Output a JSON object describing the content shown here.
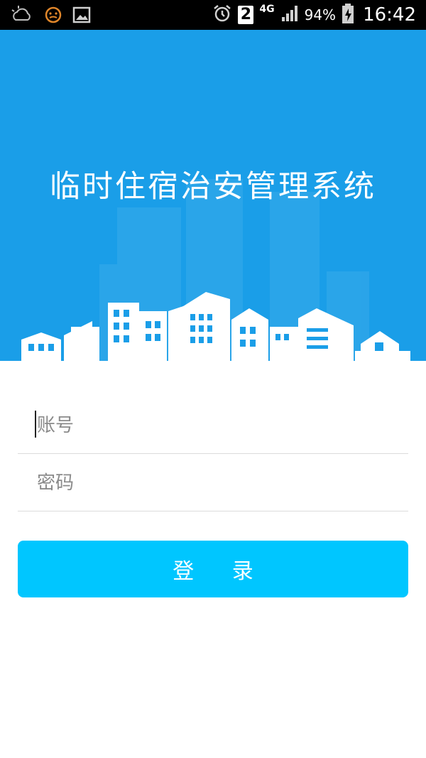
{
  "status_bar": {
    "icons_left": [
      "weather-cloudy-icon",
      "face-icon",
      "gallery-icon"
    ],
    "icons_right": [
      "alarm-clock-icon",
      "sim-slot-icon",
      "signal-icon",
      "battery-charging-icon"
    ],
    "sim_slot": "2",
    "network": "4G",
    "battery": "94%",
    "time": "16:42"
  },
  "header": {
    "title": "临时住宿治安管理系统",
    "background_color": "#1a9ee8"
  },
  "form": {
    "account_placeholder": "账号",
    "account_value": "",
    "password_placeholder": "密码",
    "password_value": ""
  },
  "login": {
    "label": "登 录",
    "color": "#00c6ff"
  }
}
